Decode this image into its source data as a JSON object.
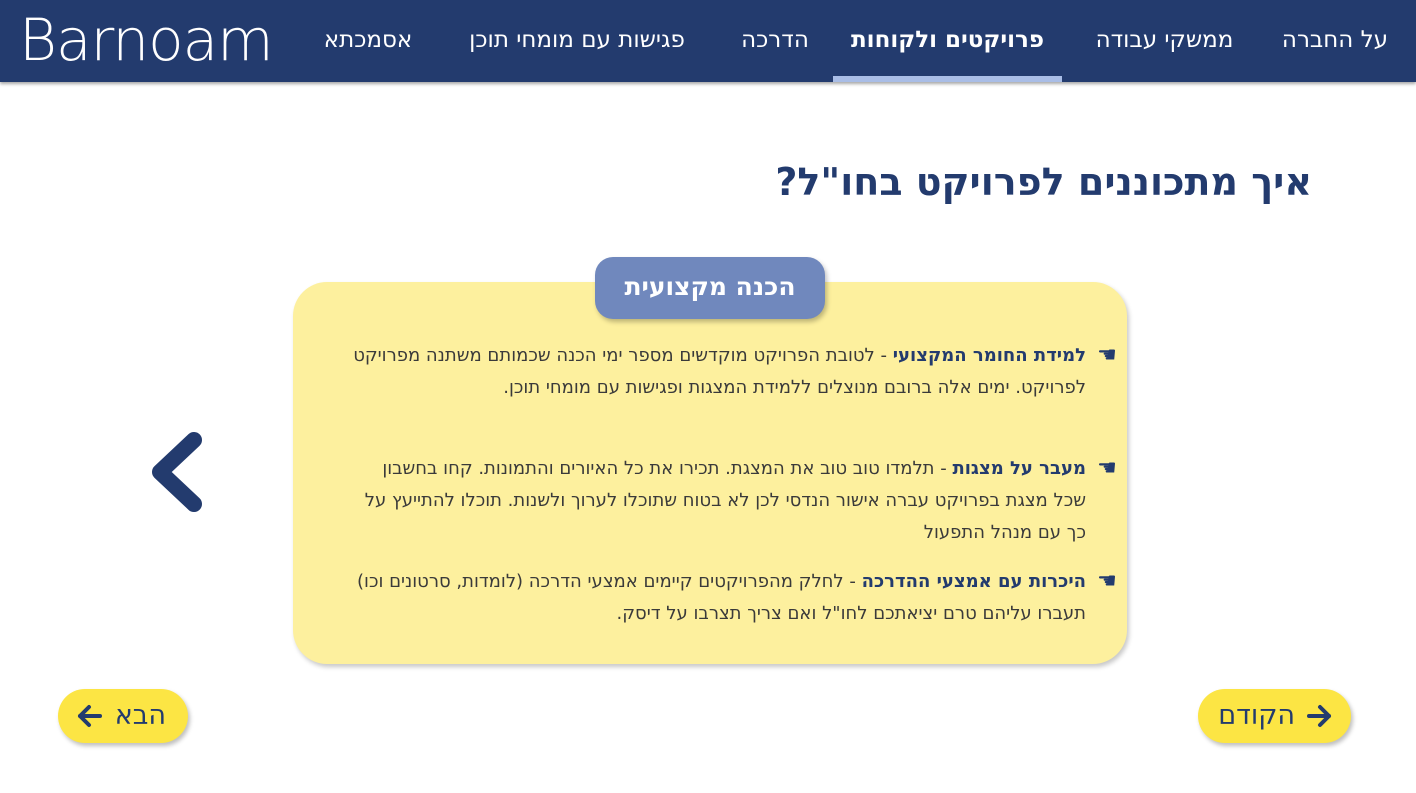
{
  "header": {
    "logo_text": "Barnoam",
    "nav": [
      {
        "label": "על החברה",
        "active": false
      },
      {
        "label": "ממשקי עבודה",
        "active": false
      },
      {
        "label": "פרויקטים ולקוחות",
        "active": true
      },
      {
        "label": "הדרכה",
        "active": false
      },
      {
        "label": "פגישות עם מומחי תוכן",
        "active": false
      },
      {
        "label": "אסמכתא",
        "active": false
      }
    ]
  },
  "main": {
    "title": "איך מתכוננים לפרויקט בחו\"ל?",
    "card": {
      "tab_label": "הכנה מקצועית",
      "items": [
        {
          "lead": "למידת החומר המקצועי",
          "text": " - לטובת הפרויקט מוקדשים מספר ימי הכנה שכמותם משתנה מפרויקט לפרויקט. ימים אלה ברובם מנוצלים ללמידת המצגות ופגישות עם מומחי תוכן.",
          "bullet_icon": "hand-pointing-icon"
        },
        {
          "lead": "מעבר על מצגות",
          "text": " - תלמדו טוב טוב את המצגת. תכירו את כל האיורים והתמונות. קחו בחשבון שכל מצגת בפרויקט עברה אישור הנדסי לכן לא בטוח שתוכלו לערוך ולשנות. תוכלו להתייעץ על כך עם מנהל התפעול",
          "bullet_icon": "hand-pointing-icon"
        },
        {
          "lead": "היכרות עם אמצעי ההדרכה",
          "text": " - לחלק מהפרויקטים קיימים אמצעי הדרכה (לומדות, סרטונים וכו) תעברו עליהם טרם יציאתכם לחו\"ל ואם צריך תצרבו על דיסק.",
          "bullet_icon": "hand-pointing-icon"
        }
      ]
    }
  },
  "footer": {
    "next_label": "הבא",
    "prev_label": "הקודם"
  },
  "colors": {
    "navy": "#233b6e",
    "card_yellow": "#fdf09e",
    "button_yellow": "#fce544",
    "tab_blue": "#7088bd"
  }
}
